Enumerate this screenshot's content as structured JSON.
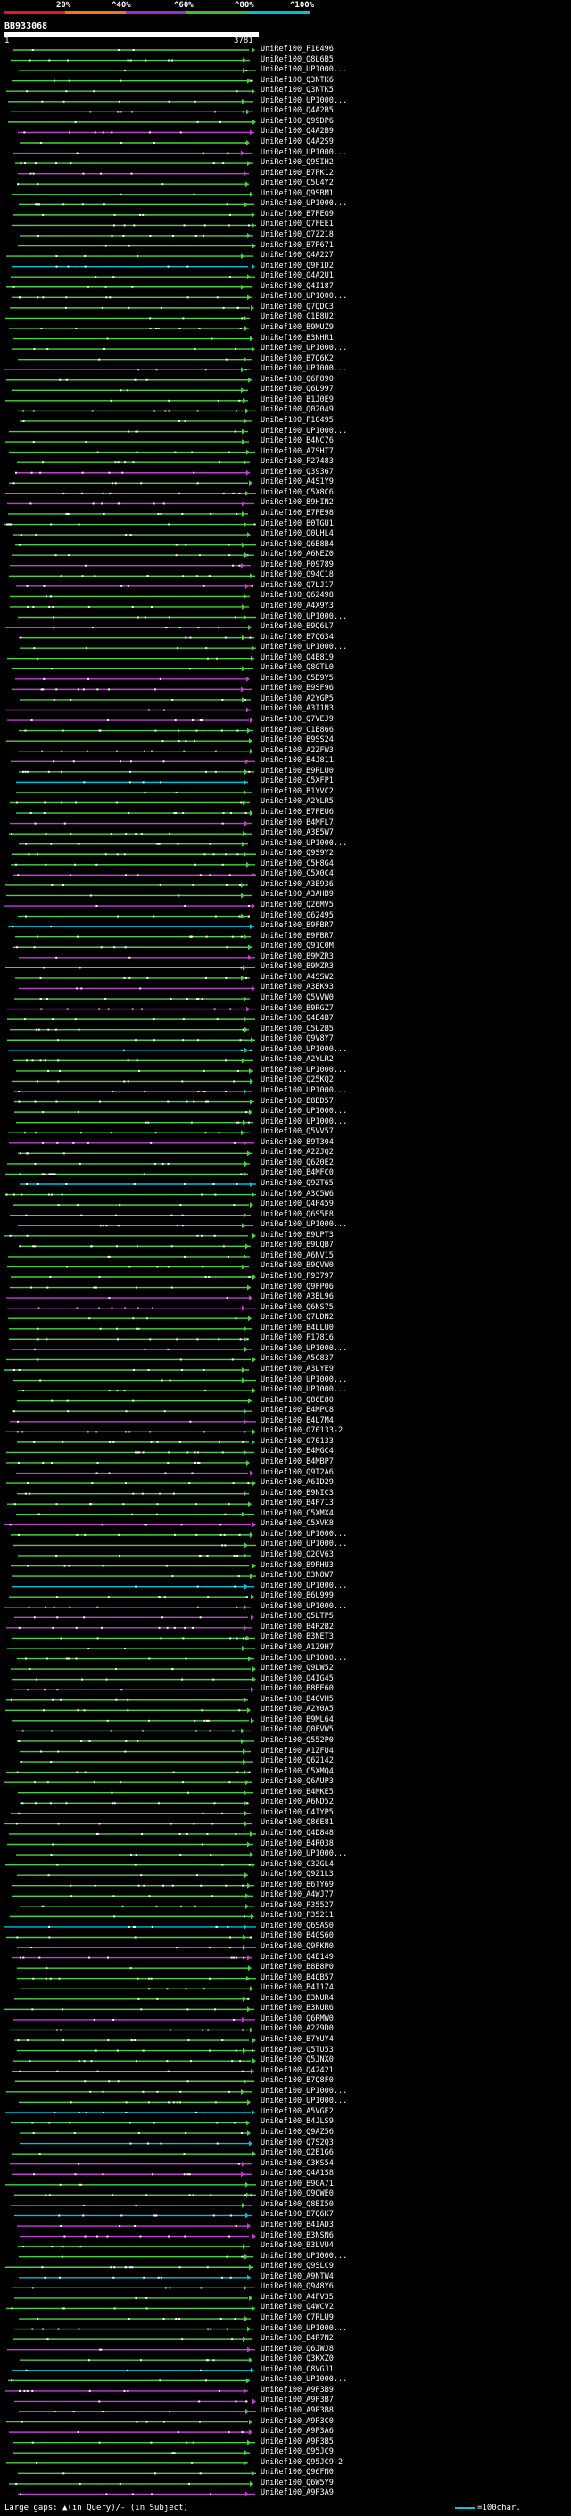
{
  "scale": {
    "labels": [
      "20%",
      "^40%",
      "^60%",
      "^80%",
      "^100%"
    ],
    "colors": [
      "#e8141e",
      "#f07818",
      "#9a2ed0",
      "#40c030",
      "#00c0d8"
    ]
  },
  "query": {
    "name": "BB933068",
    "start": "1",
    "end": "3781"
  },
  "hits": [
    "UniRef100_P10496",
    "UniRef100_Q8L6B5",
    "UniRef100_UP1000...",
    "UniRef100_Q3NTK6",
    "UniRef100_Q3NTK5",
    "UniRef100_UP1000...",
    "UniRef100_Q4A2B5",
    "UniRef100_Q99DP6",
    "UniRef100_Q4A2B9",
    "UniRef100_Q4A2S9",
    "UniRef100_UP1000...",
    "UniRef100_Q9SIH2",
    "UniRef100_B7PK12",
    "UniRef100_C5U4Y2",
    "UniRef100_Q9SBM1",
    "UniRef100_UP1000...",
    "UniRef100_B7PEG9",
    "UniRef100_Q7FEE1",
    "UniRef100_Q7Z218",
    "UniRef100_B7P671",
    "UniRef100_Q4A227",
    "UniRef100_Q9F1D2",
    "UniRef100_Q4A2U1",
    "UniRef100_Q4I187",
    "UniRef100_UP1000...",
    "UniRef100_Q7QDC3",
    "UniRef100_C1E8U2",
    "UniRef100_B9MUZ9",
    "UniRef100_B3NHR1",
    "UniRef100_UP1000...",
    "UniRef100_B7Q6K2",
    "UniRef100_UP1000...",
    "UniRef100_Q6F890",
    "UniRef100_Q6U997",
    "UniRef100_B1J0E9",
    "UniRef100_Q02049",
    "UniRef100_P10495",
    "UniRef100_UP1000...",
    "UniRef100_B4NC76",
    "UniRef100_A7SHT7",
    "UniRef100_P27483",
    "UniRef100_Q39367",
    "UniRef100_A4S1Y9",
    "UniRef100_C5X8C6",
    "UniRef100_B9HIN2",
    "UniRef100_B7PE98",
    "UniRef100_B0TGU1",
    "UniRef100_Q0UHL4",
    "UniRef100_Q6B8B4",
    "UniRef100_A6NEZ0",
    "UniRef100_P09789",
    "UniRef100_Q94C18",
    "UniRef100_Q7LJ17",
    "UniRef100_Q62498",
    "UniRef100_A4X9Y3",
    "UniRef100_UP1000...",
    "UniRef100_B9Q6L7",
    "UniRef100_B7Q634",
    "UniRef100_UP1000...",
    "UniRef100_Q4E819",
    "UniRef100_Q8GTL0",
    "UniRef100_C5D9Y5",
    "UniRef100_B9SF96",
    "UniRef100_A2YGP5",
    "UniRef100_A3I1N3",
    "UniRef100_Q7VEJ9",
    "UniRef100_C1E866",
    "UniRef100_B9SS24",
    "UniRef100_A2ZFW3",
    "UniRef100_B4J811",
    "UniRef100_B9RLU0",
    "UniRef100_C5XFP1",
    "UniRef100_B1YVC2",
    "UniRef100_A2YLR5",
    "UniRef100_B7PEU6",
    "UniRef100_B4MFL7",
    "UniRef100_A3E5W7",
    "UniRef100_UP1000...",
    "UniRef100_Q9S9Y2",
    "UniRef100_C5H8G4",
    "UniRef100_C5X0C4",
    "UniRef100_A3E936",
    "UniRef100_A3AHB9",
    "UniRef100_Q26MV5",
    "UniRef100_Q62495",
    "UniRef100_B9FBR7",
    "UniRef100_B9FBR7",
    "UniRef100_Q91C0M",
    "UniRef100_B9MZR3",
    "UniRef100_B9MZR3",
    "UniRef100_A4SSW2",
    "UniRef100_A3BK93",
    "UniRef100_Q5VVW0",
    "UniRef100_B9RGZ7",
    "UniRef100_Q4E4B7",
    "UniRef100_C5U2B5",
    "UniRef100_Q9V8Y7",
    "UniRef100_UP1000...",
    "UniRef100_A2YLR2",
    "UniRef100_UP1000...",
    "UniRef100_Q25KQ2",
    "UniRef100_UP1000...",
    "UniRef100_B8BD57",
    "UniRef100_UP1000...",
    "UniRef100_UP1000...",
    "UniRef100_Q5VV57",
    "UniRef100_B9T304",
    "UniRef100_A2ZJQ2",
    "UniRef100_Q6Z0E2",
    "UniRef100_B4MFC0",
    "UniRef100_Q9ZT65",
    "UniRef100_A3C5W6",
    "UniRef100_Q4P459",
    "UniRef100_Q6S5E8",
    "UniRef100_UP1000...",
    "UniRef100_B9UPT3",
    "UniRef100_B9UQB7",
    "UniRef100_A6NV15",
    "UniRef100_B9QVW0",
    "UniRef100_P93797",
    "UniRef100_Q9FP06",
    "UniRef100_A3BL96",
    "UniRef100_Q6NS75",
    "UniRef100_Q7UDN2",
    "UniRef100_B4LLU0",
    "UniRef100_P17816",
    "UniRef100_UP1000...",
    "UniRef100_A5C837",
    "UniRef100_A3LYE9",
    "UniRef100_UP1000...",
    "UniRef100_UP1000...",
    "UniRef100_Q86E80",
    "UniRef100_B4MPC8",
    "UniRef100_B4L7M4",
    "UniRef100_O70133-2",
    "UniRef100_O70133",
    "UniRef100_B4MGC4",
    "UniRef100_B4MBP7",
    "UniRef100_Q9T2A6",
    "UniRef100_A6ID29",
    "UniRef100_B9NIC3",
    "UniRef100_B4P713",
    "UniRef100_C5XMX4",
    "UniRef100_C5XVK8",
    "UniRef100_UP1000...",
    "UniRef100_UP1000...",
    "UniRef100_Q2GV63",
    "UniRef100_B9RHU3",
    "UniRef100_B3N8W7",
    "UniRef100_UP1000...",
    "UniRef100_B6U999",
    "UniRef100_UP1000...",
    "UniRef100_Q5LTP5",
    "UniRef100_B4R2B2",
    "UniRef100_B3NET3",
    "UniRef100_A1Z9H7",
    "UniRef100_UP1000...",
    "UniRef100_Q9LW52",
    "UniRef100_Q4IG45",
    "UniRef100_B8BE60",
    "UniRef100_B4GVH5",
    "UniRef100_A2Y0A5",
    "UniRef100_B9ML64",
    "UniRef100_Q0FVW5",
    "UniRef100_Q552P0",
    "UniRef100_A1ZFU4",
    "UniRef100_Q62142",
    "UniRef100_C5XMQ4",
    "UniRef100_Q6AUP3",
    "UniRef100_B4MKE5",
    "UniRef100_A6ND52",
    "UniRef100_C4IYP5",
    "UniRef100_Q86E81",
    "UniRef100_Q4D848",
    "UniRef100_B4R038",
    "UniRef100_UP1000...",
    "UniRef100_C3ZGL4",
    "UniRef100_Q9Z1L3",
    "UniRef100_B6TY69",
    "UniRef100_A4WJ77",
    "UniRef100_P35527",
    "UniRef100_P35211",
    "UniRef100_Q6SAS0",
    "UniRef100_B4GS60",
    "UniRef100_Q9FKN0",
    "UniRef100_Q4E149",
    "UniRef100_B8B8P0",
    "UniRef100_B4QB57",
    "UniRef100_B4I1Z4",
    "UniRef100_B3NUR4",
    "UniRef100_B3NUR6",
    "UniRef100_Q6RMW0",
    "UniRef100_A2Z9D0",
    "UniRef100_B7YUY4",
    "UniRef100_Q5TU53",
    "UniRef100_Q5JNX0",
    "UniRef100_Q42421",
    "UniRef100_B7Q8F0",
    "UniRef100_UP1000...",
    "UniRef100_UP1000...",
    "UniRef100_A5VGE2",
    "UniRef100_B4JLS9",
    "UniRef100_Q9AZ56",
    "UniRef100_Q7S2Q3",
    "UniRef100_Q2E1G6",
    "UniRef100_C3KS54",
    "UniRef100_Q4A1S8",
    "UniRef100_B9GA71",
    "UniRef100_Q9QWE0",
    "UniRef100_Q8EI50",
    "UniRef100_B7Q6K7",
    "UniRef100_B4IAD3",
    "UniRef100_B3NSN6",
    "UniRef100_B3LVU4",
    "UniRef100_UP1000...",
    "UniRef100_Q9SLC9",
    "UniRef100_A9NTW4",
    "UniRef100_Q948Y6",
    "UniRef100_A4FV35",
    "UniRef100_Q4WCV2",
    "UniRef100_C7RLU9",
    "UniRef100_UP1000...",
    "UniRef100_B4R7N2",
    "UniRef100_Q6JWJ8",
    "UniRef100_Q3KXZ0",
    "UniRef100_C8VGJ1",
    "UniRef100_UP1000...",
    "UniRef100_A9P3B9",
    "UniRef100_A9P3B7",
    "UniRef100_A9P3B8",
    "UniRef100_A9P3C0",
    "UniRef100_A9P3A6",
    "UniRef100_A9P3B5",
    "UniRef100_Q95JC9",
    "UniRef100_Q95JC9-2",
    "UniRef100_Q96FN0",
    "UniRef100_Q6W5Y9",
    "UniRef100_A9P3A9"
  ],
  "footer": {
    "left_text": "Large gaps: ▲(in Query)/- (in Subject)",
    "right_text": "=100char."
  }
}
